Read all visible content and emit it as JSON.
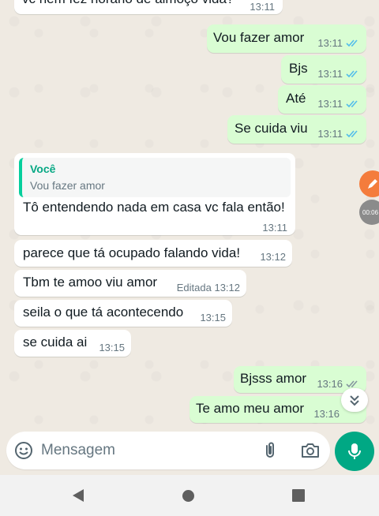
{
  "messages": [
    {
      "text": "vc nem fez horário de almoço vida?",
      "time": "13:11",
      "direction": "in"
    },
    {
      "text": "Vou fazer amor",
      "time": "13:11",
      "direction": "out",
      "status": "read"
    },
    {
      "text": "Bjs",
      "time": "13:11",
      "direction": "out",
      "status": "read"
    },
    {
      "text": "Até",
      "time": "13:11",
      "direction": "out",
      "status": "read"
    },
    {
      "text": "Se cuida viu",
      "time": "13:11",
      "direction": "out",
      "status": "read"
    },
    {
      "reply_author": "Você",
      "reply_text": "Vou fazer amor",
      "text": "Tô entendendo nada em casa vc fala então!",
      "time": "13:11",
      "direction": "in"
    },
    {
      "text": "parece que tá ocupado falando  vida!",
      "time": "13:12",
      "direction": "in"
    },
    {
      "text": "Tbm te amoo viu amor",
      "time": "Editada 13:12",
      "direction": "in"
    },
    {
      "text": "seila o que tá acontecendo",
      "time": "13:15",
      "direction": "in"
    },
    {
      "text": "se cuida ai",
      "time": "13:15",
      "direction": "in"
    },
    {
      "text": "Bjsss amor",
      "time": "13:16",
      "direction": "out",
      "status": "delivered"
    },
    {
      "text": "Te amo meu amor",
      "time": "13:16",
      "direction": "out",
      "status": "delivered"
    }
  ],
  "floating": {
    "grey_label": "00:06"
  },
  "composer": {
    "placeholder": "Mensagem"
  },
  "colors": {
    "outgoing_bubble": "#d9fdd3",
    "incoming_bubble": "#ffffff",
    "read_ticks": "#53bdeb",
    "accent": "#00a884",
    "chat_background": "#efeae2"
  },
  "icons": [
    "emoji-icon",
    "attach-clip-icon",
    "camera-icon",
    "microphone-icon",
    "double-chevron-down-icon",
    "pencil-icon",
    "back-triangle-icon",
    "home-circle-icon",
    "recent-square-icon"
  ]
}
